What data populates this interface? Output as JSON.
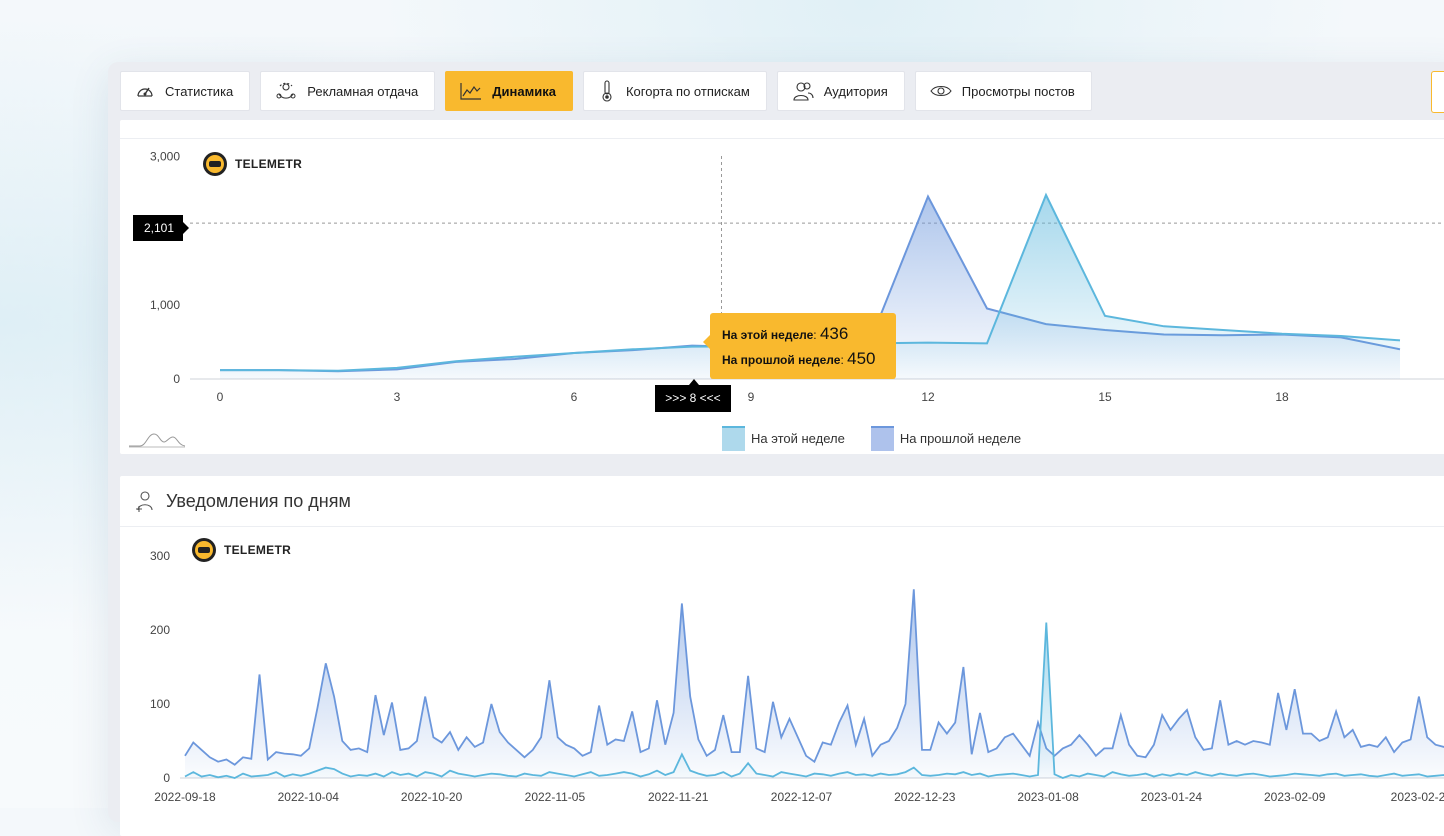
{
  "tabs": [
    {
      "label": "Статистика",
      "icon": "speedometer-icon",
      "active": false
    },
    {
      "label": "Рекламная отдача",
      "icon": "user-cycle-icon",
      "active": false
    },
    {
      "label": "Динамика",
      "icon": "area-chart-icon",
      "active": true
    },
    {
      "label": "Когорта по отпискам",
      "icon": "thermometer-icon",
      "active": false
    },
    {
      "label": "Аудитория",
      "icon": "users-icon",
      "active": false
    },
    {
      "label": "Просмотры постов",
      "icon": "eye-icon",
      "active": false
    }
  ],
  "logo_text": "TELEMETR",
  "colors": {
    "accent": "#f9b92e",
    "this_week": "#5cb7dd",
    "last_week": "#6c97dc"
  },
  "chart1": {
    "crosshair_y_label": "2,101",
    "crosshair_x_label": ">>> 8 <<<",
    "tooltip": {
      "this_label": "На этой неделе",
      "this_value": "436",
      "last_label": "На прошлой неделе",
      "last_value": "450"
    }
  },
  "chart2": {
    "title": "Уведомления по дням",
    "icon": "user-plus-icon"
  },
  "chart_data": [
    {
      "type": "area",
      "title": "",
      "x": [
        0,
        1,
        2,
        3,
        4,
        5,
        6,
        7,
        8,
        9,
        10,
        11,
        12,
        13,
        14,
        15,
        16,
        17,
        18,
        19,
        20
      ],
      "xticks": [
        "0",
        "3",
        "6",
        "9",
        "12",
        "15",
        "18"
      ],
      "yticks": [
        "0",
        "1,000",
        "3,000"
      ],
      "ylim": [
        0,
        3000
      ],
      "xlim": [
        0,
        20.5
      ],
      "series": [
        {
          "name": "На этой неделе",
          "values": [
            120,
            120,
            110,
            150,
            240,
            300,
            350,
            400,
            436,
            440,
            450,
            480,
            490,
            480,
            2480,
            850,
            710,
            660,
            610,
            580,
            520
          ]
        },
        {
          "name": "На прошлой неделе",
          "values": [
            120,
            120,
            105,
            130,
            230,
            270,
            350,
            390,
            450,
            430,
            440,
            470,
            2460,
            950,
            740,
            660,
            600,
            590,
            600,
            560,
            400
          ]
        }
      ],
      "legend": "bottom-center"
    },
    {
      "type": "area",
      "title": "Уведомления по дням",
      "x_start": "2022-09-18",
      "xticks": [
        "2022-09-18",
        "2022-10-04",
        "2022-10-20",
        "2022-11-05",
        "2022-11-21",
        "2022-12-07",
        "2022-12-23",
        "2023-01-08",
        "2023-01-24",
        "2023-02-09",
        "2023-02-2"
      ],
      "yticks": [
        "0",
        "100",
        "200",
        "300"
      ],
      "ylim": [
        0,
        300
      ],
      "series": [
        {
          "name": "series-a",
          "values": [
            30,
            48,
            38,
            28,
            22,
            25,
            18,
            28,
            26,
            140,
            25,
            35,
            33,
            32,
            30,
            40,
            95,
            155,
            110,
            50,
            38,
            40,
            35,
            112,
            58,
            102,
            38,
            40,
            50,
            110,
            55,
            48,
            62,
            38,
            55,
            42,
            48,
            100,
            62,
            48,
            38,
            28,
            38,
            55,
            132,
            55,
            45,
            40,
            30,
            35,
            98,
            45,
            52,
            50,
            90,
            35,
            40,
            105,
            45,
            88,
            236,
            110,
            52,
            30,
            38,
            85,
            35,
            35,
            138,
            40,
            35,
            103,
            55,
            80,
            55,
            30,
            22,
            48,
            45,
            75,
            98,
            45,
            80,
            30,
            45,
            50,
            68,
            100,
            255,
            38,
            38,
            75,
            60,
            75,
            150,
            32,
            88,
            35,
            40,
            55,
            60,
            45,
            30,
            75,
            40,
            30,
            40,
            45,
            58,
            45,
            30,
            40,
            40,
            85,
            45,
            30,
            28,
            45,
            85,
            65,
            80,
            92,
            55,
            38,
            40,
            105,
            45,
            50,
            45,
            50,
            48,
            45,
            115,
            65,
            120,
            60,
            60,
            50,
            55,
            90,
            55,
            65,
            42,
            45,
            42,
            55,
            35,
            48,
            52,
            110,
            55,
            45,
            42,
            45,
            48,
            40,
            45,
            42,
            52,
            48,
            90
          ]
        },
        {
          "name": "series-b",
          "values": [
            2,
            8,
            2,
            4,
            1,
            3,
            0,
            6,
            2,
            3,
            4,
            8,
            2,
            5,
            3,
            6,
            10,
            14,
            12,
            6,
            2,
            4,
            3,
            6,
            2,
            8,
            4,
            6,
            2,
            8,
            6,
            2,
            10,
            6,
            4,
            2,
            4,
            6,
            5,
            3,
            2,
            6,
            4,
            3,
            8,
            6,
            4,
            2,
            5,
            8,
            3,
            4,
            6,
            8,
            6,
            2,
            5,
            10,
            4,
            8,
            32,
            10,
            6,
            3,
            4,
            8,
            2,
            6,
            20,
            6,
            4,
            2,
            8,
            6,
            4,
            2,
            6,
            5,
            3,
            6,
            8,
            4,
            5,
            3,
            6,
            4,
            5,
            8,
            14,
            4,
            3,
            4,
            6,
            5,
            8,
            4,
            6,
            2,
            4,
            5,
            6,
            4,
            2,
            4,
            210,
            5,
            0,
            4,
            2,
            6,
            4,
            2,
            8,
            5,
            3,
            4,
            6,
            2,
            5,
            3,
            6,
            4,
            8,
            5,
            3,
            6,
            4,
            3,
            5,
            6,
            4,
            2,
            3,
            4,
            6,
            5,
            4,
            3,
            5,
            6,
            3,
            4,
            5,
            3,
            2,
            4,
            6,
            3,
            4,
            5,
            2,
            3,
            4,
            2,
            5,
            3,
            4,
            6,
            3,
            5,
            2,
            4
          ]
        }
      ]
    }
  ]
}
